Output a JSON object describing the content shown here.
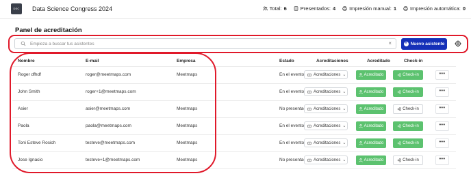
{
  "header": {
    "logo_text": "DSC",
    "event_title": "Data Science Congress 2024",
    "stats": [
      {
        "label": "Total:",
        "value": "6",
        "icon": "people-icon"
      },
      {
        "label": "Presentados:",
        "value": "4",
        "icon": "presented-icon"
      },
      {
        "label": "Impresión manual:",
        "value": "1",
        "icon": "printer-icon"
      },
      {
        "label": "Impresión automática:",
        "value": "0",
        "icon": "printer-icon"
      }
    ]
  },
  "panel": {
    "title": "Panel de acreditación",
    "search_placeholder": "Empieza a buscar tus asistentes",
    "clear_symbol": "×",
    "new_button_label": "Nuevo asistente",
    "new_button_icon": "+"
  },
  "table": {
    "columns": [
      "Nombre",
      "E-mail",
      "Empresa",
      "Estado",
      "Acreditaciones",
      "Acreditado",
      "Check-in"
    ],
    "rows": [
      {
        "name": "Roger dfhdf",
        "email": "roger@meetmaps.com",
        "company": "Meetmaps",
        "status": "En el evento",
        "accreditations": "Acreditaciones",
        "accredited": "Acreditado",
        "checkin": "Check-in",
        "checkin_done": true
      },
      {
        "name": "John Smith",
        "email": "roger+1@meetmaps.com",
        "company": "",
        "status": "En el evento",
        "accreditations": "Acreditaciones",
        "accredited": "Acreditado",
        "checkin": "Check-in",
        "checkin_done": true
      },
      {
        "name": "Asier",
        "email": "asier@meetmaps.com",
        "company": "Meetmaps",
        "status": "No presentado",
        "accreditations": "Acreditaciones",
        "accredited": "Acreditado",
        "checkin": "Check-in",
        "checkin_done": false
      },
      {
        "name": "Paola",
        "email": "paola@meetmaps.com",
        "company": "Meetmaps",
        "status": "En el evento",
        "accreditations": "Acreditaciones",
        "accredited": "Acreditado",
        "checkin": "Check-in",
        "checkin_done": true
      },
      {
        "name": "Toni Esteve Rosich",
        "email": "testeve@meetmaps.com",
        "company": "Meetmaps",
        "status": "En el evento",
        "accreditations": "Acreditaciones",
        "accredited": "Acreditado",
        "checkin": "Check-in",
        "checkin_done": true
      },
      {
        "name": "Jose Ignacio",
        "email": "testeve+1@meetmaps.com",
        "company": "Meetmaps",
        "status": "No presentado",
        "accreditations": "Acreditaciones",
        "accredited": "Acreditado",
        "checkin": "Check-in",
        "checkin_done": false
      }
    ],
    "more_symbol": "•••"
  },
  "colors": {
    "primary": "#1530b8",
    "success": "#5cc26f",
    "annotation": "#e0192a"
  }
}
